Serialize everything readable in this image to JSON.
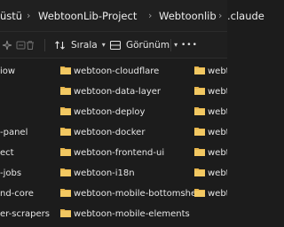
{
  "address_bar": {
    "crumbs": [
      "üstü",
      "WebtoonLib-Project",
      "Webtoonlib",
      ".claude"
    ]
  },
  "toolbar": {
    "sort_label": "Sırala",
    "view_label": "Görünüm",
    "more_label": "•••",
    "icons": [
      "sparkle-icon",
      "rename-icon",
      "trash-icon",
      "sort-icon",
      "view-icon",
      "more-icon"
    ]
  },
  "files": {
    "left_column_partial": [
      "iow",
      "-panel",
      "ect",
      "-jobs",
      "nd-core",
      "er-scrapers"
    ],
    "middle_column": [
      "webtoon-cloudflare",
      "webtoon-data-layer",
      "webtoon-deploy",
      "webtoon-docker",
      "webtoon-frontend-ui",
      "webtoon-i18n",
      "webtoon-mobile-bottomsheet",
      "webtoon-mobile-elements"
    ],
    "right_column_partial": [
      "webtoo",
      "webtoo",
      "webtoo",
      "webtoo",
      "webtoo",
      "webtoo",
      "webtoo"
    ]
  },
  "colors": {
    "folder": "#e8b64c",
    "background": "#1c1c1c",
    "text": "#e6e6e6"
  }
}
